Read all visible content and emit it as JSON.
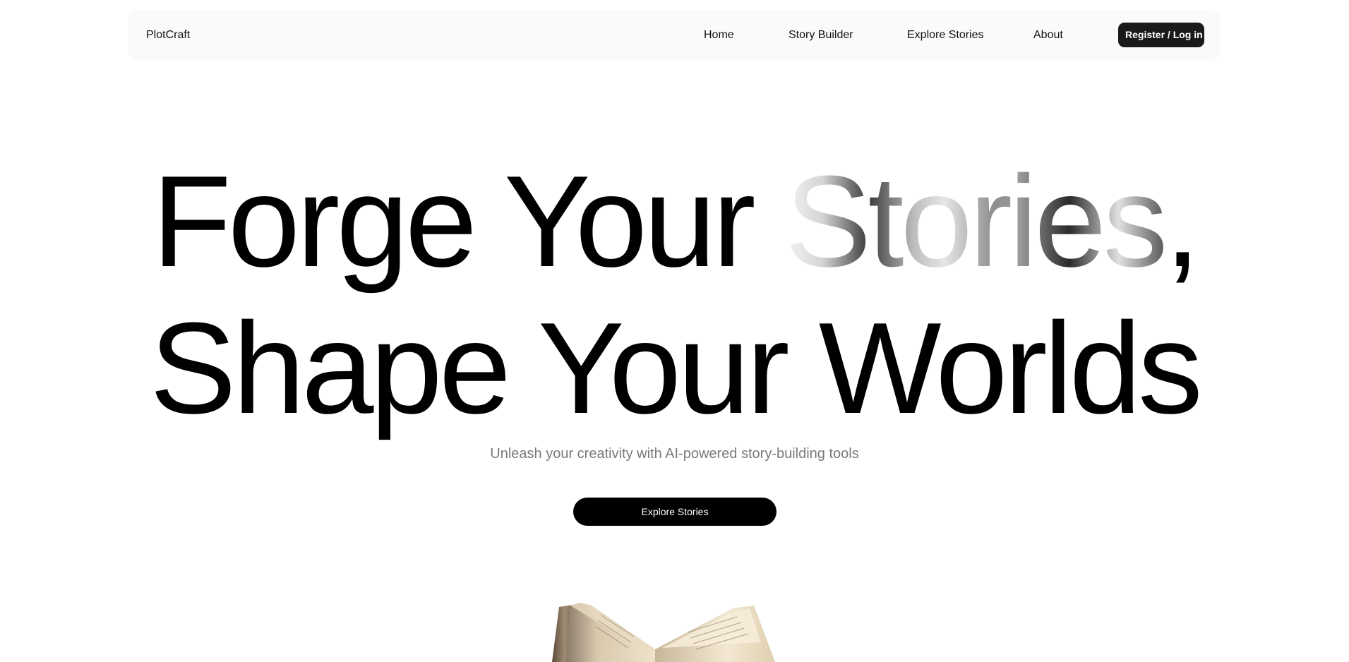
{
  "nav": {
    "brand": "PlotCraft",
    "links": [
      {
        "label": "Home"
      },
      {
        "label": "Story Builder"
      },
      {
        "label": "Explore Stories"
      },
      {
        "label": "About"
      }
    ],
    "auth_button": "Register / Log in"
  },
  "hero": {
    "line1_part1": "Forge Your ",
    "line1_highlight": "Stories",
    "line1_comma": ",",
    "line2": "Shape Your Worlds",
    "subtitle": "Unleash your creativity with AI-powered story-building tools",
    "cta_label": "Explore Stories"
  },
  "colors": {
    "nav_background": "#fafafa",
    "button_dark": "#1a1a1a",
    "cta_background": "#000000",
    "subtitle_text": "#7a7a7a"
  },
  "icons": {
    "hero_image": "open-book-image"
  }
}
